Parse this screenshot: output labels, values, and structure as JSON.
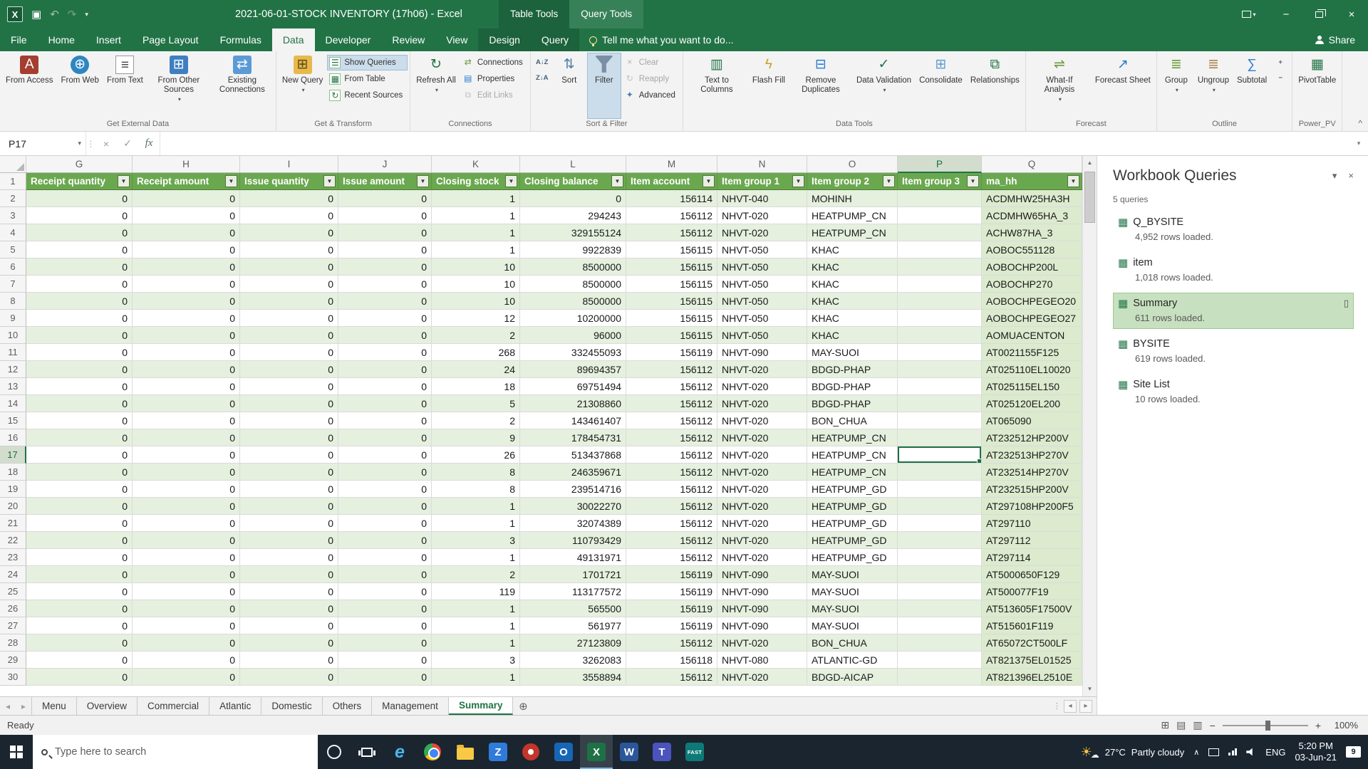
{
  "colors": {
    "accent": "#217346",
    "hdr": "#6AA84F",
    "band": "#E5F0DE",
    "qcol": "#DCEACE"
  },
  "title_bar": {
    "title": "2021-06-01-STOCK INVENTORY (17h06) - Excel",
    "contextual": [
      "Table Tools",
      "Query Tools"
    ]
  },
  "ribbon_tabs": [
    {
      "label": "File"
    },
    {
      "label": "Home"
    },
    {
      "label": "Insert"
    },
    {
      "label": "Page Layout"
    },
    {
      "label": "Formulas"
    },
    {
      "label": "Data",
      "active": true
    },
    {
      "label": "Developer"
    },
    {
      "label": "Review"
    },
    {
      "label": "View"
    },
    {
      "label": "Design",
      "contextual": true
    },
    {
      "label": "Query",
      "contextual": true
    }
  ],
  "tellme_label": "Tell me what you want to do...",
  "share_label": "Share",
  "ribbon": {
    "groups": [
      {
        "label": "Get External Data",
        "items": [
          {
            "type": "big",
            "label": "From Access",
            "icon": "access-icon"
          },
          {
            "type": "big",
            "label": "From Web",
            "icon": "globe-icon"
          },
          {
            "type": "big",
            "label": "From Text",
            "icon": "text-file-icon"
          },
          {
            "type": "big",
            "label": "From Other Sources",
            "icon": "other-sources-icon",
            "dropdown": true
          },
          {
            "type": "big",
            "label": "Existing Connections",
            "icon": "existing-connections-icon"
          }
        ]
      },
      {
        "label": "Get & Transform",
        "items": [
          {
            "type": "big",
            "label": "New Query",
            "icon": "new-query-icon",
            "dropdown": true
          },
          {
            "type": "col",
            "buttons": [
              {
                "label": "Show Queries",
                "icon": "show-queries-icon",
                "active": true
              },
              {
                "label": "From Table",
                "icon": "from-table-icon"
              },
              {
                "label": "Recent Sources",
                "icon": "recent-sources-icon"
              }
            ]
          }
        ]
      },
      {
        "label": "Connections",
        "items": [
          {
            "type": "big",
            "label": "Refresh All",
            "icon": "refresh-icon",
            "dropdown": true
          },
          {
            "type": "col",
            "buttons": [
              {
                "label": "Connections",
                "icon": "connections-icon"
              },
              {
                "label": "Properties",
                "icon": "properties-icon"
              },
              {
                "label": "Edit Links",
                "icon": "edit-links-icon",
                "disabled": true
              }
            ]
          }
        ]
      },
      {
        "label": "Sort & Filter",
        "items": [
          {
            "type": "col",
            "buttons": [
              {
                "label": "A↓Z",
                "icon": "sort-ascending-icon",
                "tiny": true
              },
              {
                "label": "Z↓A",
                "icon": "sort-descending-icon",
                "tiny": true
              }
            ]
          },
          {
            "type": "big",
            "label": "Sort",
            "icon": "sort-icon"
          },
          {
            "type": "big",
            "label": "Filter",
            "icon": "filter-icon",
            "active": true
          },
          {
            "type": "col",
            "buttons": [
              {
                "label": "Clear",
                "icon": "clear-filter-icon",
                "disabled": true
              },
              {
                "label": "Reapply",
                "icon": "reapply-icon",
                "disabled": true
              },
              {
                "label": "Advanced",
                "icon": "advanced-filter-icon"
              }
            ]
          }
        ]
      },
      {
        "label": "Data Tools",
        "items": [
          {
            "type": "big",
            "label": "Text to Columns",
            "icon": "text-to-columns-icon"
          },
          {
            "type": "big",
            "label": "Flash Fill",
            "icon": "flash-fill-icon"
          },
          {
            "type": "big",
            "label": "Remove Duplicates",
            "icon": "remove-duplicates-icon"
          },
          {
            "type": "big",
            "label": "Data Validation",
            "icon": "data-validation-icon",
            "dropdown": true
          },
          {
            "type": "big",
            "label": "Consolidate",
            "icon": "consolidate-icon"
          },
          {
            "type": "big",
            "label": "Relationships",
            "icon": "relationships-icon"
          }
        ]
      },
      {
        "label": "Forecast",
        "items": [
          {
            "type": "big",
            "label": "What-If Analysis",
            "icon": "what-if-analysis-icon",
            "dropdown": true
          },
          {
            "type": "big",
            "label": "Forecast Sheet",
            "icon": "forecast-sheet-icon"
          }
        ]
      },
      {
        "label": "Outline",
        "items": [
          {
            "type": "big",
            "label": "Group",
            "icon": "group-icon",
            "dropdown": true
          },
          {
            "type": "big",
            "label": "Ungroup",
            "icon": "ungroup-icon",
            "dropdown": true
          },
          {
            "type": "big",
            "label": "Subtotal",
            "icon": "subtotal-icon"
          },
          {
            "type": "col",
            "buttons": [
              {
                "label": "+",
                "icon": "show-detail-icon",
                "tiny": true
              },
              {
                "label": "−",
                "icon": "hide-detail-icon",
                "tiny": true
              }
            ]
          }
        ]
      },
      {
        "label": "Power_PV",
        "items": [
          {
            "type": "big",
            "label": "PivotTable",
            "icon": "pivottable-icon"
          }
        ]
      }
    ]
  },
  "formula_bar": {
    "name_box": "P17",
    "fx_label": "fx",
    "value": ""
  },
  "grid": {
    "columns": [
      "G",
      "H",
      "I",
      "J",
      "K",
      "L",
      "M",
      "N",
      "O",
      "P",
      "Q"
    ],
    "selected_col": "P",
    "selected_row": 17,
    "selected_cell": "P17",
    "header_cells": [
      "Receipt quantity",
      "Receipt amount",
      "Issue quantity",
      "Issue amount",
      "Closing stock",
      "Closing balance",
      "Item account",
      "Item group 1",
      "Item group 2",
      "Item group 3",
      "ma_hh"
    ],
    "rows": [
      {
        "n": 2,
        "c": [
          "0",
          "0",
          "0",
          "0",
          "1",
          "0",
          "156114",
          "NHVT-040",
          "MOHINH",
          "",
          "ACDMHW25HA3H"
        ]
      },
      {
        "n": 3,
        "c": [
          "0",
          "0",
          "0",
          "0",
          "1",
          "294243",
          "156112",
          "NHVT-020",
          "HEATPUMP_CN",
          "",
          "ACDMHW65HA_3"
        ]
      },
      {
        "n": 4,
        "c": [
          "0",
          "0",
          "0",
          "0",
          "1",
          "329155124",
          "156112",
          "NHVT-020",
          "HEATPUMP_CN",
          "",
          "ACHW87HA_3"
        ]
      },
      {
        "n": 5,
        "c": [
          "0",
          "0",
          "0",
          "0",
          "1",
          "9922839",
          "156115",
          "NHVT-050",
          "KHAC",
          "",
          "AOBOC551128"
        ]
      },
      {
        "n": 6,
        "c": [
          "0",
          "0",
          "0",
          "0",
          "10",
          "8500000",
          "156115",
          "NHVT-050",
          "KHAC",
          "",
          "AOBOCHP200L"
        ]
      },
      {
        "n": 7,
        "c": [
          "0",
          "0",
          "0",
          "0",
          "10",
          "8500000",
          "156115",
          "NHVT-050",
          "KHAC",
          "",
          "AOBOCHP270"
        ]
      },
      {
        "n": 8,
        "c": [
          "0",
          "0",
          "0",
          "0",
          "10",
          "8500000",
          "156115",
          "NHVT-050",
          "KHAC",
          "",
          "AOBOCHPEGEO20"
        ]
      },
      {
        "n": 9,
        "c": [
          "0",
          "0",
          "0",
          "0",
          "12",
          "10200000",
          "156115",
          "NHVT-050",
          "KHAC",
          "",
          "AOBOCHPEGEO27"
        ]
      },
      {
        "n": 10,
        "c": [
          "0",
          "0",
          "0",
          "0",
          "2",
          "96000",
          "156115",
          "NHVT-050",
          "KHAC",
          "",
          "AOMUACENTON"
        ]
      },
      {
        "n": 11,
        "c": [
          "0",
          "0",
          "0",
          "0",
          "268",
          "332455093",
          "156119",
          "NHVT-090",
          "MAY-SUOI",
          "",
          "AT0021155F125"
        ]
      },
      {
        "n": 12,
        "c": [
          "0",
          "0",
          "0",
          "0",
          "24",
          "89694357",
          "156112",
          "NHVT-020",
          "BDGD-PHAP",
          "",
          "AT025110EL10020"
        ]
      },
      {
        "n": 13,
        "c": [
          "0",
          "0",
          "0",
          "0",
          "18",
          "69751494",
          "156112",
          "NHVT-020",
          "BDGD-PHAP",
          "",
          "AT025115EL150"
        ]
      },
      {
        "n": 14,
        "c": [
          "0",
          "0",
          "0",
          "0",
          "5",
          "21308860",
          "156112",
          "NHVT-020",
          "BDGD-PHAP",
          "",
          "AT025120EL200"
        ]
      },
      {
        "n": 15,
        "c": [
          "0",
          "0",
          "0",
          "0",
          "2",
          "143461407",
          "156112",
          "NHVT-020",
          "BON_CHUA",
          "",
          "AT065090"
        ]
      },
      {
        "n": 16,
        "c": [
          "0",
          "0",
          "0",
          "0",
          "9",
          "178454731",
          "156112",
          "NHVT-020",
          "HEATPUMP_CN",
          "",
          "AT232512HP200V"
        ]
      },
      {
        "n": 17,
        "c": [
          "0",
          "0",
          "0",
          "0",
          "26",
          "513437868",
          "156112",
          "NHVT-020",
          "HEATPUMP_CN",
          "",
          "AT232513HP270V"
        ]
      },
      {
        "n": 18,
        "c": [
          "0",
          "0",
          "0",
          "0",
          "8",
          "246359671",
          "156112",
          "NHVT-020",
          "HEATPUMP_CN",
          "",
          "AT232514HP270V"
        ]
      },
      {
        "n": 19,
        "c": [
          "0",
          "0",
          "0",
          "0",
          "8",
          "239514716",
          "156112",
          "NHVT-020",
          "HEATPUMP_GD",
          "",
          "AT232515HP200V"
        ]
      },
      {
        "n": 20,
        "c": [
          "0",
          "0",
          "0",
          "0",
          "1",
          "30022270",
          "156112",
          "NHVT-020",
          "HEATPUMP_GD",
          "",
          "AT297108HP200F5"
        ]
      },
      {
        "n": 21,
        "c": [
          "0",
          "0",
          "0",
          "0",
          "1",
          "32074389",
          "156112",
          "NHVT-020",
          "HEATPUMP_GD",
          "",
          "AT297110"
        ]
      },
      {
        "n": 22,
        "c": [
          "0",
          "0",
          "0",
          "0",
          "3",
          "110793429",
          "156112",
          "NHVT-020",
          "HEATPUMP_GD",
          "",
          "AT297112"
        ]
      },
      {
        "n": 23,
        "c": [
          "0",
          "0",
          "0",
          "0",
          "1",
          "49131971",
          "156112",
          "NHVT-020",
          "HEATPUMP_GD",
          "",
          "AT297114"
        ]
      },
      {
        "n": 24,
        "c": [
          "0",
          "0",
          "0",
          "0",
          "2",
          "1701721",
          "156119",
          "NHVT-090",
          "MAY-SUOI",
          "",
          "AT5000650F129"
        ]
      },
      {
        "n": 25,
        "c": [
          "0",
          "0",
          "0",
          "0",
          "119",
          "113177572",
          "156119",
          "NHVT-090",
          "MAY-SUOI",
          "",
          "AT500077F19"
        ]
      },
      {
        "n": 26,
        "c": [
          "0",
          "0",
          "0",
          "0",
          "1",
          "565500",
          "156119",
          "NHVT-090",
          "MAY-SUOI",
          "",
          "AT513605F17500V"
        ]
      },
      {
        "n": 27,
        "c": [
          "0",
          "0",
          "0",
          "0",
          "1",
          "561977",
          "156119",
          "NHVT-090",
          "MAY-SUOI",
          "",
          "AT515601F119"
        ]
      },
      {
        "n": 28,
        "c": [
          "0",
          "0",
          "0",
          "0",
          "1",
          "27123809",
          "156112",
          "NHVT-020",
          "BON_CHUA",
          "",
          "AT65072CT500LF"
        ]
      },
      {
        "n": 29,
        "c": [
          "0",
          "0",
          "0",
          "0",
          "3",
          "3262083",
          "156118",
          "NHVT-080",
          "ATLANTIC-GD",
          "",
          "AT821375EL01525"
        ]
      },
      {
        "n": 30,
        "c": [
          "0",
          "0",
          "0",
          "0",
          "1",
          "3558894",
          "156112",
          "NHVT-020",
          "BDGD-AICAP",
          "",
          "AT821396EL2510E"
        ]
      }
    ]
  },
  "queries_panel": {
    "title": "Workbook Queries",
    "count_label": "5 queries",
    "items": [
      {
        "name": "Q_BYSITE",
        "detail": "4,952 rows loaded."
      },
      {
        "name": "item",
        "detail": "1,018 rows loaded."
      },
      {
        "name": "Summary",
        "detail": "611 rows loaded.",
        "selected": true
      },
      {
        "name": "BYSITE",
        "detail": "619 rows loaded."
      },
      {
        "name": "Site List",
        "detail": "10 rows loaded."
      }
    ]
  },
  "sheet_tabs": {
    "tabs": [
      "Menu",
      "Overview",
      "Commercial",
      "Atlantic",
      "Domestic",
      "Others",
      "Management",
      "Summary"
    ],
    "active": "Summary"
  },
  "status_bar": {
    "mode": "Ready",
    "zoom": "100%"
  },
  "taskbar": {
    "search_placeholder": "Type here to search",
    "pinned": [
      {
        "name": "cortana-icon",
        "style": "cortana"
      },
      {
        "name": "task-view-icon",
        "style": "taskview"
      },
      {
        "name": "edge-icon",
        "style": "edge",
        "glyph": "e"
      },
      {
        "name": "chrome-icon",
        "style": "chrome"
      },
      {
        "name": "file-explorer-icon",
        "style": "folder"
      },
      {
        "name": "pinned-app-icon-blue",
        "style": "sq",
        "glyph": "Z",
        "color": "#2F7BD9"
      },
      {
        "name": "pinned-app-icon-red",
        "style": "dot",
        "color": "#C4352B"
      },
      {
        "name": "outlook-icon",
        "style": "sq",
        "glyph": "O",
        "color": "#1766B5"
      },
      {
        "name": "excel-icon",
        "style": "sq",
        "glyph": "X",
        "color": "#1E7145",
        "active": true
      },
      {
        "name": "word-icon",
        "style": "sq",
        "glyph": "W",
        "color": "#2B579A"
      },
      {
        "name": "teams-icon",
        "style": "sq",
        "glyph": "T",
        "color": "#4B53BC"
      },
      {
        "name": "fast-icon",
        "style": "sq",
        "glyph": "FAST",
        "color": "#0D7A77"
      }
    ],
    "tray": {
      "weather_temp": "27°C",
      "weather_text": "Partly cloudy",
      "language": "ENG",
      "time": "5:20 PM",
      "date": "03-Jun-21",
      "notification_count": "9"
    }
  }
}
